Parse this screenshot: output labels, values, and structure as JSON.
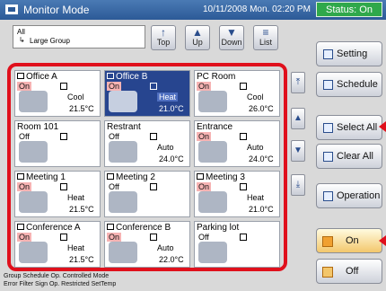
{
  "header": {
    "title": "Monitor Mode",
    "datetime": "10/11/2008 Mon. 02:20 PM",
    "status": "Status: On"
  },
  "group": {
    "line1": "All",
    "line2": "Large Group"
  },
  "nav": [
    {
      "label": "Top",
      "icon": "↑"
    },
    {
      "label": "Up",
      "icon": "▲"
    },
    {
      "label": "Down",
      "icon": "▼"
    },
    {
      "label": "List",
      "icon": "≡"
    }
  ],
  "side": {
    "setting": "Setting",
    "schedule": "Schedule",
    "select_all": "Select All",
    "clear_all": "Clear All",
    "operation": "Operation",
    "on": "On",
    "off": "Off"
  },
  "tiles": [
    {
      "name": "Office A",
      "state": "On",
      "mode": "Cool",
      "temp": "21.5°C"
    },
    {
      "name": "Office B",
      "state": "On",
      "mode": "Heat",
      "temp": "21.0°C"
    },
    {
      "name": "PC Room",
      "state": "On",
      "mode": "Cool",
      "temp": "26.0°C"
    },
    {
      "name": "Room 101",
      "state": "Off",
      "mode": "",
      "temp": ""
    },
    {
      "name": "Restrant",
      "state": "Off",
      "mode": "Auto",
      "temp": "24.0°C"
    },
    {
      "name": "Entrance",
      "state": "On",
      "mode": "Auto",
      "temp": "24.0°C"
    },
    {
      "name": "Meeting 1",
      "state": "On",
      "mode": "Heat",
      "temp": "21.5°C"
    },
    {
      "name": "Meeting 2",
      "state": "Off",
      "mode": "",
      "temp": ""
    },
    {
      "name": "Meeting 3",
      "state": "On",
      "mode": "Heat",
      "temp": "21.0°C"
    },
    {
      "name": "Conference A",
      "state": "On",
      "mode": "Heat",
      "temp": "21.5°C"
    },
    {
      "name": "Conference B",
      "state": "On",
      "mode": "Auto",
      "temp": "22.0°C"
    },
    {
      "name": "Parking lot",
      "state": "Off",
      "mode": "",
      "temp": ""
    }
  ],
  "legend": {
    "line1": "Group  Schedule  Op. Controlled  Mode",
    "line2": "Error  Filter Sign  Op. Restricted  SetTemp"
  },
  "colors": {
    "accent": "#27458f",
    "highlight": "#e0101c",
    "status_on": "#2fa84b"
  }
}
